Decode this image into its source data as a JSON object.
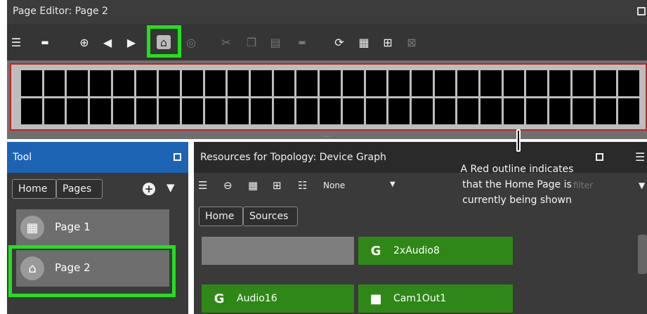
{
  "window": {
    "title": "Page Editor: Page 2"
  },
  "toolbar": {
    "icons": [
      "list-icon",
      "keyboard-icon",
      "add-circle-icon",
      "arrow-left-circle-icon",
      "arrow-right-circle-icon",
      "home-page-icon",
      "shield-icon",
      "cut-icon",
      "copy-icon",
      "paste-icon",
      "layer-icon",
      "refresh-icon",
      "grid-large-icon",
      "grid-small-icon",
      "clear-grid-icon"
    ]
  },
  "tool_panel": {
    "title": "Tool",
    "breadcrumb": [
      "Home",
      "Pages"
    ],
    "pages": [
      {
        "label": "Page 1",
        "icon": "grid-icon"
      },
      {
        "label": "Page 2",
        "icon": "home-icon"
      }
    ]
  },
  "resources_panel": {
    "title": "Resources for Topology: Device Graph",
    "dropdown_value": "None",
    "filter_placeholder": "filter",
    "breadcrumb": [
      "Home",
      "Sources"
    ],
    "tiles": [
      {
        "label": "",
        "icon": ""
      },
      {
        "label": "2xAudio8",
        "icon": "audio-device-icon"
      },
      {
        "label": "Audio16",
        "icon": "audio-device-icon"
      },
      {
        "label": "Cam1Out1",
        "icon": "camera-icon"
      }
    ]
  },
  "annotation": {
    "text": "A Red outline indicates that the Home Page is currently being shown"
  },
  "colors": {
    "highlight_green": "#22e01c",
    "outline_red": "#c22424",
    "tool_header_blue": "#1d63b4",
    "tile_green": "#2f8718"
  }
}
